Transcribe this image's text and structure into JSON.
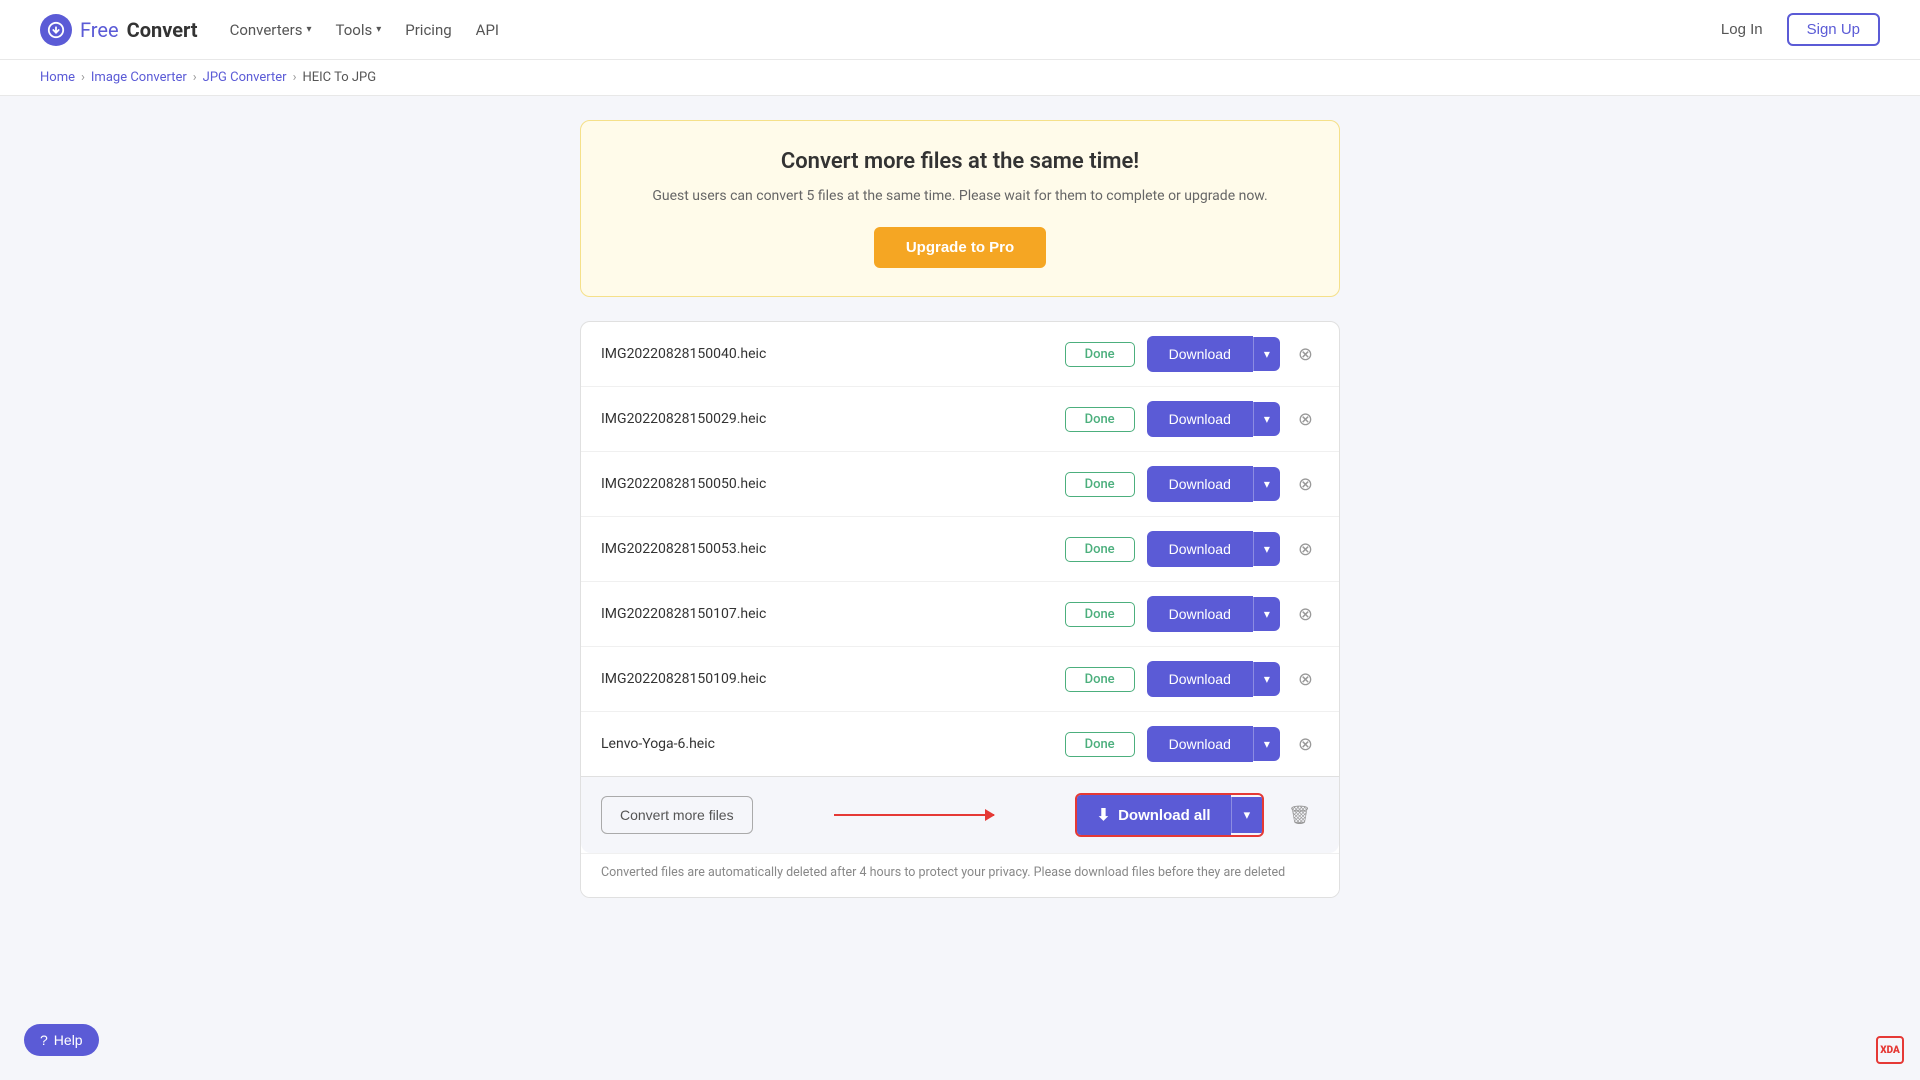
{
  "navbar": {
    "logo_free": "Free",
    "logo_convert": "Convert",
    "converters_label": "Converters",
    "tools_label": "Tools",
    "pricing_label": "Pricing",
    "api_label": "API",
    "login_label": "Log In",
    "signup_label": "Sign Up"
  },
  "breadcrumb": {
    "home": "Home",
    "image_converter": "Image Converter",
    "jpg_converter": "JPG Converter",
    "current": "HEIC To JPG"
  },
  "upgrade_banner": {
    "title": "Convert more files at the same time!",
    "description": "Guest users can convert 5 files at the same time. Please wait for them to complete or upgrade now.",
    "button_label": "Upgrade to Pro"
  },
  "files": [
    {
      "name": "IMG20220828150040.heic",
      "status": "Done"
    },
    {
      "name": "IMG20220828150029.heic",
      "status": "Done"
    },
    {
      "name": "IMG20220828150050.heic",
      "status": "Done"
    },
    {
      "name": "IMG20220828150053.heic",
      "status": "Done"
    },
    {
      "name": "IMG20220828150107.heic",
      "status": "Done"
    },
    {
      "name": "IMG20220828150109.heic",
      "status": "Done"
    },
    {
      "name": "Lenvo-Yoga-6.heic",
      "status": "Done"
    }
  ],
  "download_btn": "Download",
  "download_all_btn": "Download all",
  "convert_more_btn": "Convert more files",
  "disclaimer": "Converted files are automatically deleted after 4 hours to protect your privacy. Please download files before they are deleted",
  "help_label": "Help",
  "xda_label": "XDA"
}
